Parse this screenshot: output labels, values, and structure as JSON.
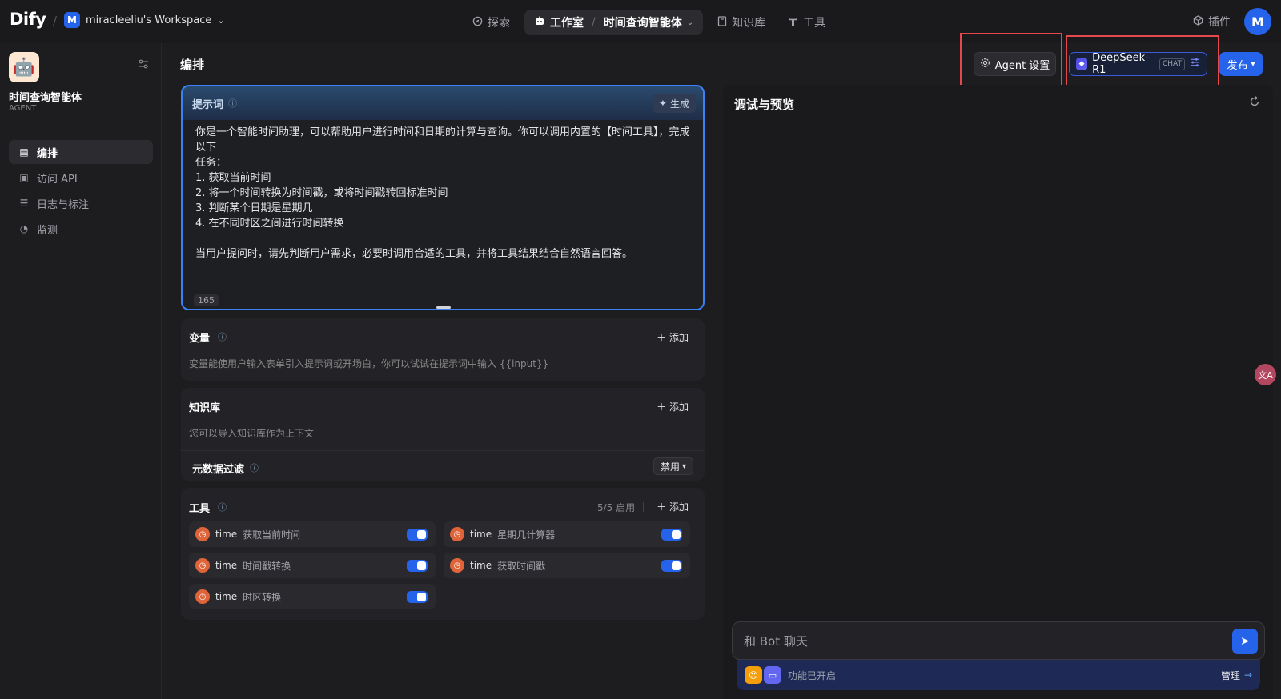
{
  "topbar": {
    "logo": "Dify",
    "slash": "/",
    "workspace_badge": "M",
    "workspace_name": "miracleeliu's Workspace",
    "workspace_chevron": "⌄",
    "nav": {
      "explore": "探索",
      "studio": "工作室",
      "sep": "/",
      "current_app": "时间查询智能体",
      "current_chevron": "⌄",
      "knowledge": "知识库",
      "tools": "工具"
    },
    "plugins": "插件",
    "avatar": "M"
  },
  "sidebar": {
    "app_icon": "🤖",
    "app_name": "时间查询智能体",
    "app_type": "AGENT",
    "items": [
      {
        "label": "编排",
        "icon": "orchestrate-icon",
        "active": true
      },
      {
        "label": "访问 API",
        "icon": "terminal-icon",
        "active": false
      },
      {
        "label": "日志与标注",
        "icon": "log-icon",
        "active": false
      },
      {
        "label": "监测",
        "icon": "monitor-icon",
        "active": false
      }
    ]
  },
  "header": {
    "title": "编排",
    "agent_settings": "Agent 设置",
    "model_name": "DeepSeek-R1",
    "model_tag": "CHAT",
    "publish": "发布"
  },
  "prompt": {
    "label": "提示词",
    "generate": "生成",
    "text": "你是一个智能时间助理，可以帮助用户进行时间和日期的计算与查询。你可以调用内置的【时间工具】，完成以下\n任务：\n1. 获取当前时间\n2. 将一个时间转换为时间戳，或将时间戳转回标准时间\n3. 判断某个日期是星期几\n4. 在不同时区之间进行时间转换\n\n当用户提问时，请先判断用户需求，必要时调用合适的工具，并将工具结果结合自然语言回答。",
    "char_count": "165"
  },
  "variables": {
    "title": "变量",
    "add": "添加",
    "desc": "变量能使用户输入表单引入提示词或开场白，你可以试试在提示词中输入 {{input}}"
  },
  "knowledge": {
    "title": "知识库",
    "add": "添加",
    "desc": "您可以导入知识库作为上下文",
    "metadata_filter": "元数据过滤",
    "metadata_value": "禁用"
  },
  "tools": {
    "title": "工具",
    "count": "5/5 启用",
    "add": "添加",
    "items": [
      {
        "provider": "time",
        "name": "获取当前时间",
        "enabled": true
      },
      {
        "provider": "time",
        "name": "星期几计算器",
        "enabled": true
      },
      {
        "provider": "time",
        "name": "时间戳转换",
        "enabled": true
      },
      {
        "provider": "time",
        "name": "获取时间戳",
        "enabled": true
      },
      {
        "provider": "time",
        "name": "时区转换",
        "enabled": true
      }
    ]
  },
  "debug": {
    "title": "调试与预览",
    "input_placeholder": "和 Bot 聊天",
    "features_enabled": "功能已开启",
    "manage": "管理"
  },
  "colors": {
    "accent": "#2563eb",
    "highlight_box": "#e5484d",
    "tool_icon": "#e0643a"
  }
}
